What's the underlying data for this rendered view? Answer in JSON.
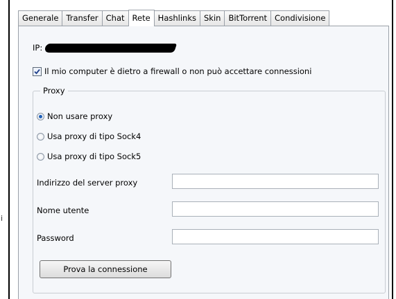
{
  "tabs": [
    "Generale",
    "Transfer",
    "Chat",
    "Rete",
    "Hashlinks",
    "Skin",
    "BitTorrent",
    "Condivisione"
  ],
  "active_tab": "Rete",
  "stray_char": "i",
  "ip": {
    "label": "IP:",
    "value_redacted": true
  },
  "firewall": {
    "label": "Il mio computer è dietro a firewall o non può accettare connessioni",
    "checked": true
  },
  "proxy": {
    "legend": "Proxy",
    "options": [
      {
        "label": "Non usare proxy",
        "selected": true
      },
      {
        "label": "Usa proxy di tipo Sock4",
        "selected": false
      },
      {
        "label": "Usa proxy di tipo Sock5",
        "selected": false
      }
    ],
    "server_label": "Indirizzo del server proxy",
    "server_value": "",
    "user_label": "Nome utente",
    "user_value": "",
    "password_label": "Password",
    "password_value": "",
    "test_button": "Prova la connessione"
  }
}
